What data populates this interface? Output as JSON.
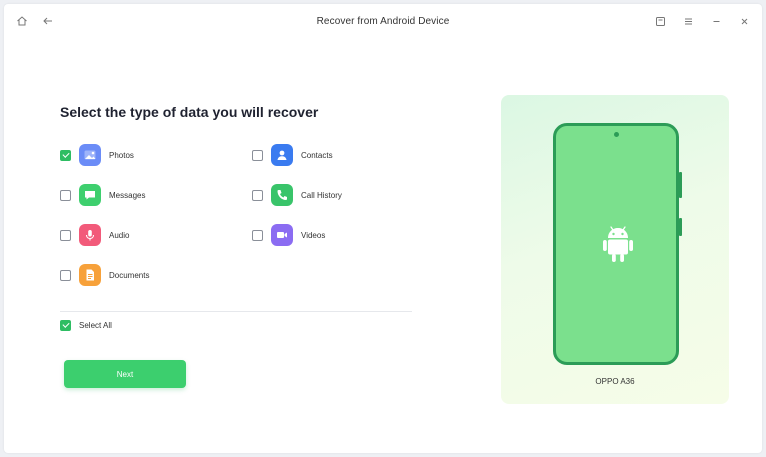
{
  "window": {
    "title": "Recover from Android Device"
  },
  "main": {
    "heading": "Select the type of data you will recover",
    "options": [
      {
        "label": "Photos",
        "checked": true,
        "icon": "photos-icon",
        "color": "#6b8cf7"
      },
      {
        "label": "Contacts",
        "checked": false,
        "icon": "contacts-icon",
        "color": "#3a7bf0"
      },
      {
        "label": "Messages",
        "checked": false,
        "icon": "messages-icon",
        "color": "#3ecf6e"
      },
      {
        "label": "Call History",
        "checked": false,
        "icon": "call-history-icon",
        "color": "#39c46a"
      },
      {
        "label": "Audio",
        "checked": false,
        "icon": "audio-icon",
        "color": "#f25a7a"
      },
      {
        "label": "Videos",
        "checked": false,
        "icon": "videos-icon",
        "color": "#8b6cf2"
      },
      {
        "label": "Documents",
        "checked": false,
        "icon": "documents-icon",
        "color": "#f7a13a"
      }
    ],
    "select_all": {
      "label": "Select All",
      "checked": true
    },
    "next_label": "Next"
  },
  "device": {
    "name": "OPPO A36"
  },
  "colors": {
    "accent": "#3ccf6e",
    "phone_body": "#7be08d",
    "phone_border": "#2c9c57"
  }
}
